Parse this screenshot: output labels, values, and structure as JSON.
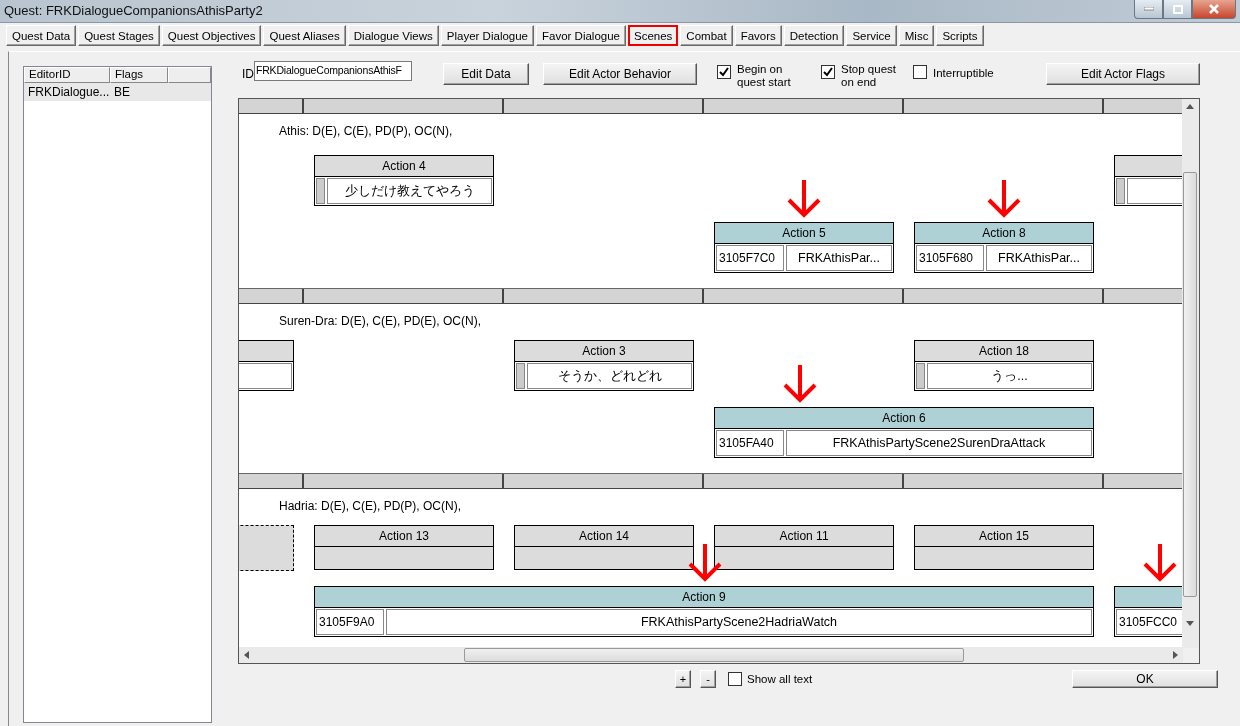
{
  "window": {
    "title": "Quest: FRKDialogueCompanionsAthisParty2"
  },
  "tabs": [
    {
      "label": "Quest Data",
      "selected": false
    },
    {
      "label": "Quest Stages",
      "selected": false
    },
    {
      "label": "Quest Objectives",
      "selected": false
    },
    {
      "label": "Quest Aliases",
      "selected": false
    },
    {
      "label": "Dialogue Views",
      "selected": false
    },
    {
      "label": "Player Dialogue",
      "selected": false
    },
    {
      "label": "Favor Dialogue",
      "selected": false
    },
    {
      "label": "Scenes",
      "selected": true
    },
    {
      "label": "Combat",
      "selected": false
    },
    {
      "label": "Favors",
      "selected": false
    },
    {
      "label": "Detection",
      "selected": false
    },
    {
      "label": "Service",
      "selected": false
    },
    {
      "label": "Misc",
      "selected": false
    },
    {
      "label": "Scripts",
      "selected": false
    }
  ],
  "scene_list": {
    "columns": [
      "EditorID",
      "Flags"
    ],
    "rows": [
      {
        "cells": [
          "FRKDialogue...",
          "BE"
        ],
        "selected": true
      }
    ]
  },
  "scene": {
    "id_label": "ID",
    "id_value": "FRKDialogueCompanionsAthisF",
    "buttons": [
      "Edit Data",
      "Edit Actor Behavior"
    ],
    "options": [
      {
        "label": "Begin on quest start",
        "checked": true
      },
      {
        "label": "Stop quest on end",
        "checked": true
      },
      {
        "label": "Interruptible",
        "checked": false
      }
    ],
    "flags_button": "Edit Actor Flags"
  },
  "lanes": [
    {
      "actor": "Athis: D(E), C(E), PD(P), OC(N),",
      "actions": [
        {
          "kind": "dialogue",
          "label": "Action 4",
          "line": "少しだけ教えてやろう",
          "marked": false
        },
        {
          "kind": "dialogue"
        },
        {
          "kind": "package",
          "label": "Action 5",
          "id": "3105F7C0",
          "name": "FRKAthisPar...",
          "marked": true
        },
        {
          "kind": "package",
          "label": "Action 8",
          "id": "3105F680",
          "name": "FRKAthisPar...",
          "marked": true
        }
      ]
    },
    {
      "actor": "Suren-Dra: D(E), C(E), PD(E), OC(N),",
      "actions": [
        {
          "kind": "dialogue"
        },
        {
          "kind": "dialogue",
          "label": "Action 3",
          "line": "そうか、どれどれ",
          "marked": false
        },
        {
          "kind": "dialogue",
          "label": "Action 18",
          "line": "うっ...",
          "marked": false
        },
        {
          "kind": "package",
          "label": "Action 6",
          "id": "3105FA40",
          "name": "FRKAthisPartyScene2SurenDraAttack",
          "marked": true
        }
      ]
    },
    {
      "actor": "Hadria: D(E), C(E), PD(P), OC(N),",
      "actions": [
        {
          "kind": "ghost"
        },
        {
          "kind": "empty",
          "label": "Action 13",
          "marked": false
        },
        {
          "kind": "empty",
          "label": "Action 14",
          "marked": false
        },
        {
          "kind": "empty",
          "label": "Action 11",
          "marked": false
        },
        {
          "kind": "empty",
          "label": "Action 15",
          "marked": false
        },
        {
          "kind": "package",
          "label": "Action 9",
          "id": "3105F9A0",
          "name": "FRKAthisPartyScene2HadriaWatch",
          "marked": true
        },
        {
          "kind": "package",
          "id": "3105FCC0",
          "marked": true
        }
      ]
    }
  ],
  "zoom_buttons": [
    "+",
    "-"
  ],
  "show_all_text": {
    "label": "Show all text",
    "checked": false
  },
  "ok_button": "OK"
}
